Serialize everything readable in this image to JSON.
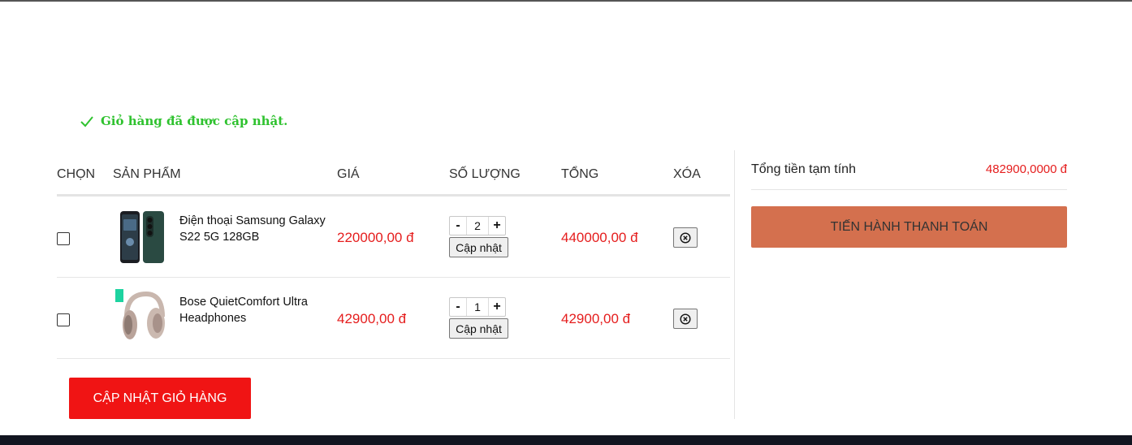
{
  "notice": {
    "text": "Giỏ hàng đã được cập nhật."
  },
  "table": {
    "headers": {
      "select": "CHỌN",
      "product": "SẢN PHẨM",
      "price": "GIÁ",
      "quantity": "SỐ LƯỢNG",
      "total": "TỔNG",
      "delete": "XÓA"
    },
    "items": [
      {
        "name": "Điện thoại Samsung Galaxy S22 5G 128GB",
        "image_icon": "phone-image",
        "price": "220000,00 đ",
        "quantity": "2",
        "update_label": "Cập nhật",
        "total": "440000,00 đ",
        "checked": false
      },
      {
        "name": "Bose QuietComfort Ultra Headphones",
        "image_icon": "headphones-image",
        "price": "42900,00 đ",
        "quantity": "1",
        "update_label": "Cập nhật",
        "total": "42900,00 đ",
        "checked": false
      }
    ],
    "qty_minus": "-",
    "qty_plus": "+"
  },
  "actions": {
    "update_cart": "CẬP NHẬT GIỎ HÀNG"
  },
  "summary": {
    "subtotal_label": "Tổng tiền tạm tính",
    "subtotal_value": "482900,0000 đ",
    "checkout": "TIẾN HÀNH THANH TOÁN"
  },
  "colors": {
    "price_red": "#e51d1d",
    "success_green": "#2fc22f",
    "update_cart_bg": "#f01414",
    "checkout_bg": "#d4704e"
  }
}
